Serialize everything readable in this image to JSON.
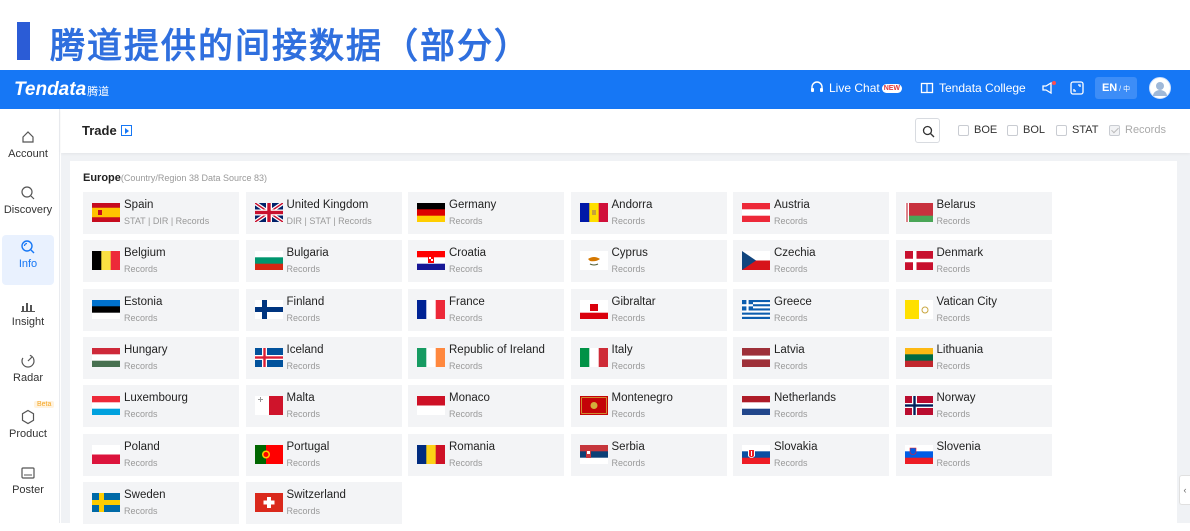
{
  "banner": {
    "title": "腾道提供的间接数据（部分）"
  },
  "topnav": {
    "logo": "Tendata",
    "logo_cn": "腾道",
    "live_chat": "Live Chat",
    "new_badge": "NEW",
    "college": "Tendata College",
    "lang": "EN",
    "lang_alt": "中"
  },
  "sidebar": {
    "items": [
      {
        "label": "Account",
        "icon": "home-icon"
      },
      {
        "label": "Discovery",
        "icon": "search-icon"
      },
      {
        "label": "Info",
        "icon": "info-search-icon",
        "active": true
      },
      {
        "label": "Insight",
        "icon": "bar-chart-icon"
      },
      {
        "label": "Radar",
        "icon": "radar-icon"
      },
      {
        "label": "Product",
        "icon": "hexagon-icon",
        "badge": "Beta"
      },
      {
        "label": "Poster",
        "icon": "poster-icon"
      }
    ]
  },
  "toolbar": {
    "title": "Trade",
    "filters": [
      {
        "label": "BOE",
        "checked": false
      },
      {
        "label": "BOL",
        "checked": false
      },
      {
        "label": "STAT",
        "checked": false
      },
      {
        "label": "Records",
        "checked": true,
        "disabled": true
      }
    ]
  },
  "region": {
    "name": "Europe",
    "info": "(Country/Region 38 Data Source 83)"
  },
  "countries": [
    {
      "name": "Spain",
      "sub": "STAT | DIR | Records"
    },
    {
      "name": "United Kingdom",
      "sub": "DIR | STAT | Records"
    },
    {
      "name": "Germany",
      "sub": "Records"
    },
    {
      "name": "Andorra",
      "sub": "Records"
    },
    {
      "name": "Austria",
      "sub": "Records"
    },
    {
      "name": "Belarus",
      "sub": "Records"
    },
    {
      "name": "Belgium",
      "sub": "Records"
    },
    {
      "name": "Bulgaria",
      "sub": "Records"
    },
    {
      "name": "Croatia",
      "sub": "Records"
    },
    {
      "name": "Cyprus",
      "sub": "Records"
    },
    {
      "name": "Czechia",
      "sub": "Records"
    },
    {
      "name": "Denmark",
      "sub": "Records"
    },
    {
      "name": "Estonia",
      "sub": "Records"
    },
    {
      "name": "Finland",
      "sub": "Records"
    },
    {
      "name": "France",
      "sub": "Records"
    },
    {
      "name": "Gibraltar",
      "sub": "Records"
    },
    {
      "name": "Greece",
      "sub": "Records"
    },
    {
      "name": "Vatican City",
      "sub": "Records"
    },
    {
      "name": "Hungary",
      "sub": "Records"
    },
    {
      "name": "Iceland",
      "sub": "Records"
    },
    {
      "name": "Republic of Ireland",
      "sub": "Records"
    },
    {
      "name": "Italy",
      "sub": "Records"
    },
    {
      "name": "Latvia",
      "sub": "Records"
    },
    {
      "name": "Lithuania",
      "sub": "Records"
    },
    {
      "name": "Luxembourg",
      "sub": "Records"
    },
    {
      "name": "Malta",
      "sub": "Records"
    },
    {
      "name": "Monaco",
      "sub": "Records"
    },
    {
      "name": "Montenegro",
      "sub": "Records"
    },
    {
      "name": "Netherlands",
      "sub": "Records"
    },
    {
      "name": "Norway",
      "sub": "Records"
    },
    {
      "name": "Poland",
      "sub": "Records"
    },
    {
      "name": "Portugal",
      "sub": "Records"
    },
    {
      "name": "Romania",
      "sub": "Records"
    },
    {
      "name": "Serbia",
      "sub": "Records"
    },
    {
      "name": "Slovakia",
      "sub": "Records"
    },
    {
      "name": "Slovenia",
      "sub": "Records"
    },
    {
      "name": "Sweden",
      "sub": "Records"
    },
    {
      "name": "Switzerland",
      "sub": "Records"
    }
  ]
}
